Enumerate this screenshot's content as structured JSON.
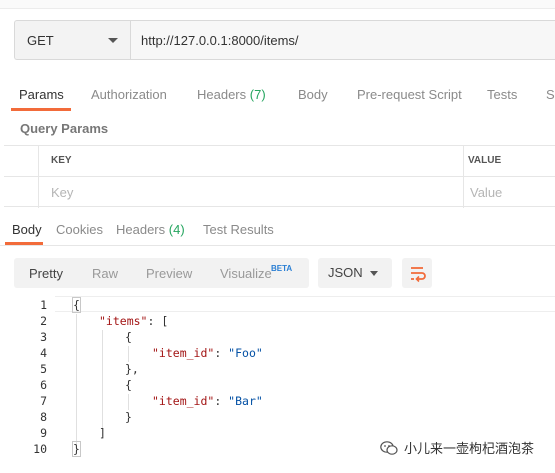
{
  "request": {
    "method": "GET",
    "url": "http://127.0.0.1:8000/items/"
  },
  "request_tabs": [
    {
      "label": "Params"
    },
    {
      "label": "Authorization"
    },
    {
      "label": "Headers",
      "count": "(7)"
    },
    {
      "label": "Body"
    },
    {
      "label": "Pre-request Script"
    },
    {
      "label": "Tests"
    },
    {
      "label": "Se"
    }
  ],
  "query_params": {
    "title": "Query Params",
    "columns": [
      "KEY",
      "VALUE"
    ],
    "placeholders": {
      "key": "Key",
      "value": "Value"
    }
  },
  "response_tabs": [
    {
      "label": "Body"
    },
    {
      "label": "Cookies"
    },
    {
      "label": "Headers",
      "count": "(4)"
    },
    {
      "label": "Test Results"
    }
  ],
  "view_options": {
    "pretty": "Pretty",
    "raw": "Raw",
    "preview": "Preview",
    "visualize": "Visualize",
    "beta": "BETA",
    "format": "JSON"
  },
  "code_lines": [
    {
      "n": "1"
    },
    {
      "n": "2"
    },
    {
      "n": "3"
    },
    {
      "n": "4"
    },
    {
      "n": "5"
    },
    {
      "n": "6"
    },
    {
      "n": "7"
    },
    {
      "n": "8"
    },
    {
      "n": "9"
    },
    {
      "n": "10"
    }
  ],
  "code": {
    "open_brace": "{",
    "items_key": "\"items\"",
    "colon_bracket": ": [",
    "obj_open": "{",
    "item_key": "\"item_id\"",
    "colon": ": ",
    "val1": "\"Foo\"",
    "obj_close_comma": "},",
    "val2": "\"Bar\"",
    "obj_close": "}",
    "arr_close": "]",
    "close_brace": "}"
  },
  "watermark": "小儿来一壶枸杞酒泡茶",
  "colors": {
    "accent": "#f26b3a",
    "count": "#25a55f",
    "json_key": "#a31515",
    "json_string": "#0451a5"
  }
}
